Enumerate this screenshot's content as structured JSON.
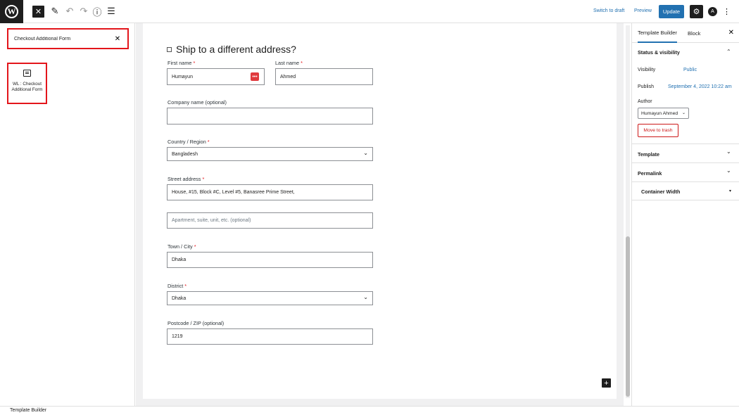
{
  "toolbar": {
    "wp_logo": "W",
    "close_icon": "✕",
    "edit_icon": "✎",
    "undo_icon": "↶",
    "redo_icon": "↷",
    "info_icon": "ⓘ",
    "list_icon": "☰",
    "switch_to_draft": "Switch to draft",
    "preview": "Preview",
    "update": "Update",
    "settings_icon": "⚙",
    "astra_icon": "A",
    "more_icon": "⋮"
  },
  "inserter": {
    "search_value": "Checkout Additional Form",
    "clear_icon": "✕",
    "result_label": "WL : Checkout Additional Form"
  },
  "form": {
    "ship_label": "Ship to a different address?",
    "required_mark": "*",
    "first_name_label": "First name",
    "first_name_value": "Humayun",
    "autofill_icon": "•••",
    "last_name_label": "Last name",
    "last_name_value": "Ahmed",
    "company_label": "Company name (optional)",
    "company_value": "",
    "country_label": "Country / Region",
    "country_value": "Bangladesh",
    "street_label": "Street address",
    "street_value": "House, #15, Block #C, Level #5, Banasree Prime Street,",
    "apartment_placeholder": "Apartment, suite, unit, etc. (optional)",
    "town_label": "Town / City",
    "town_value": "Dhaka",
    "district_label": "District",
    "district_value": "Dhaka",
    "postcode_label": "Postcode / ZIP (optional)",
    "postcode_value": "1219",
    "chevron": "⌄",
    "add_block_icon": "+"
  },
  "sidebar": {
    "tab_template": "Template Builder",
    "tab_block": "Block",
    "close_icon": "✕",
    "status_title": "Status & visibility",
    "chevron_up": "⌃",
    "chevron_down": "⌄",
    "visibility_label": "Visibility",
    "visibility_value": "Public",
    "publish_label": "Publish",
    "publish_value": "September 4, 2022 10:22 am",
    "author_label": "Author",
    "author_value": "Humayun Ahmed",
    "trash_label": "Move to trash",
    "template_title": "Template",
    "permalink_title": "Permalink",
    "container_width_title": "Container Width",
    "caret_icon": "▾"
  },
  "statusbar": {
    "breadcrumb": "Template Builder"
  },
  "colors": {
    "accent": "#2271b1",
    "highlight": "#e3151b",
    "danger": "#cc1818"
  }
}
